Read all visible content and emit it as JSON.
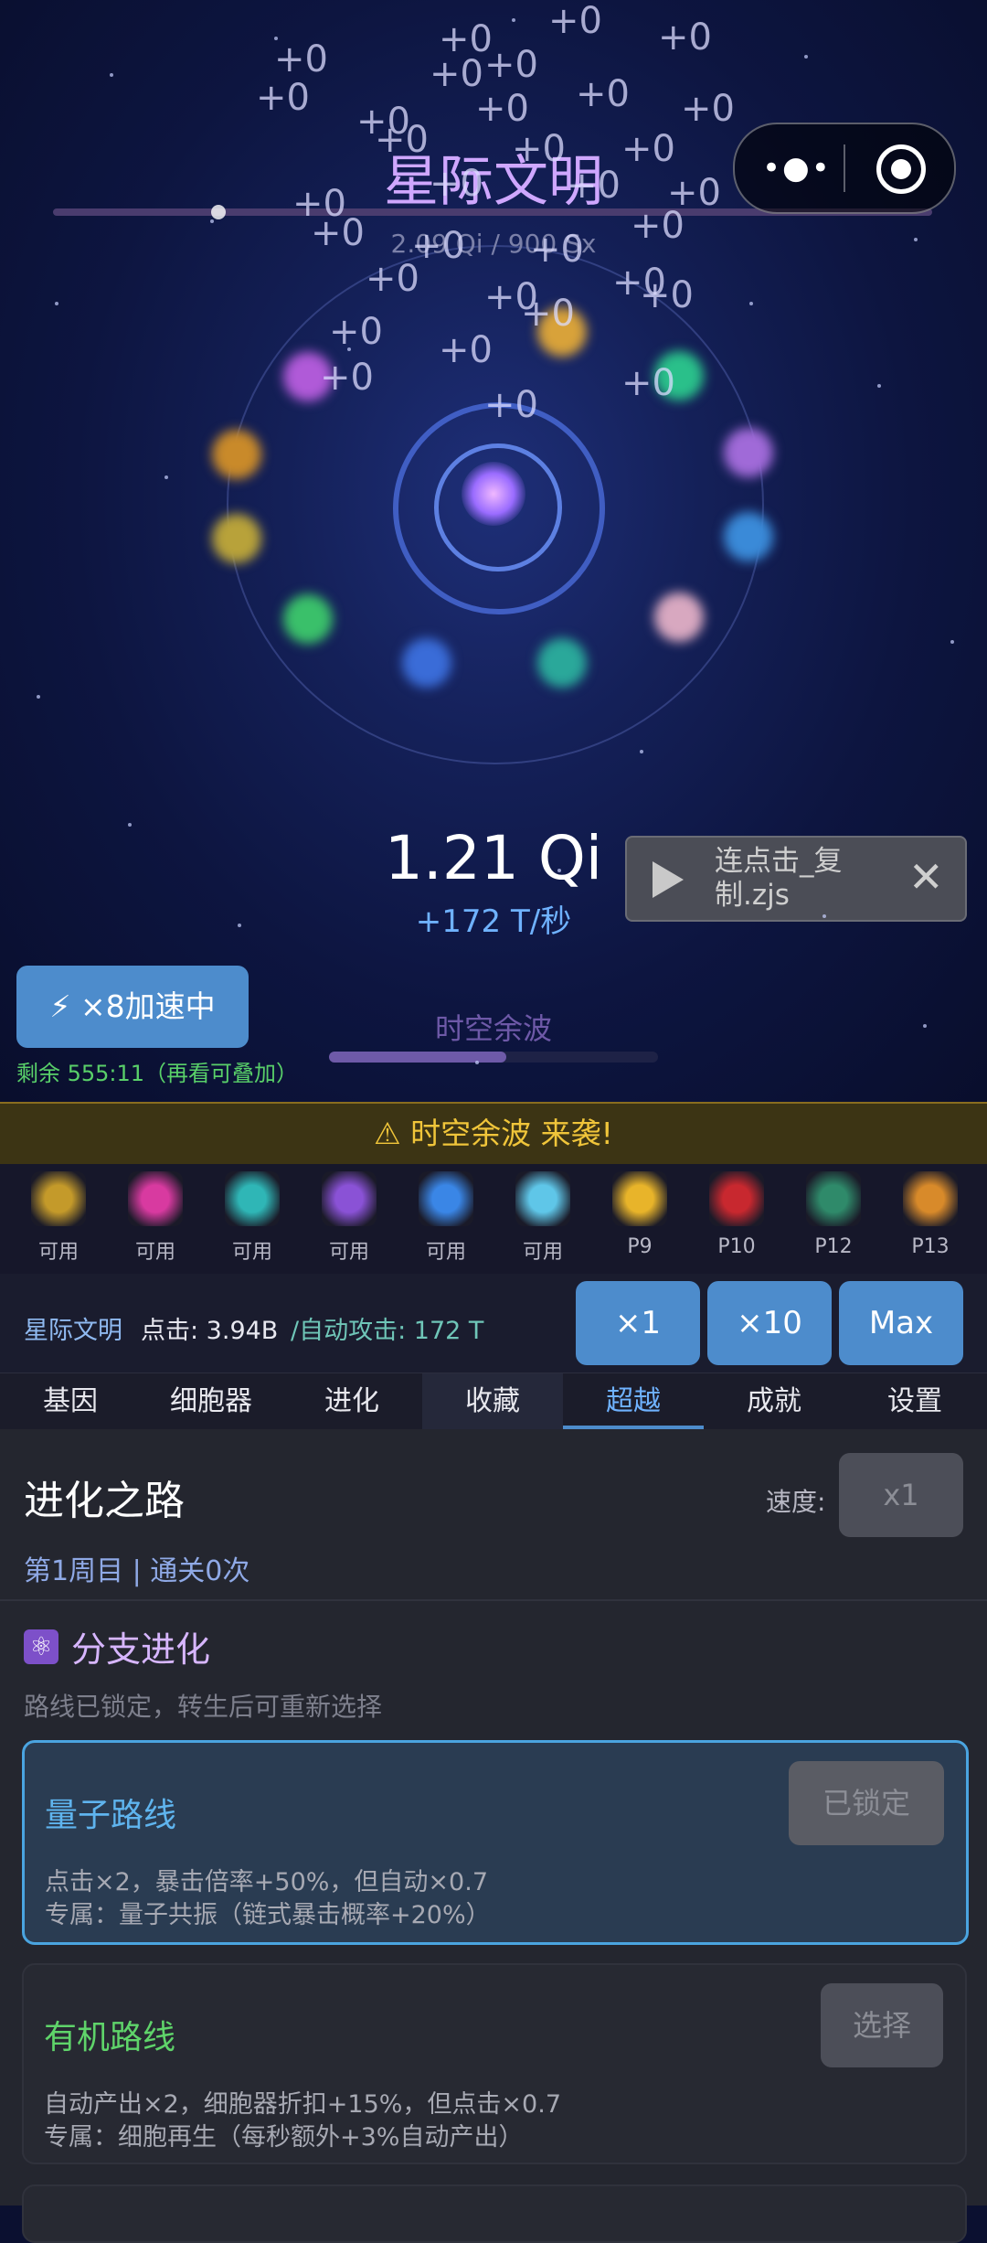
{
  "game": {
    "title": "星际文明",
    "subtitle": "2.09 Qi / 900 Sx",
    "float_text": "+0",
    "counter": "1.21 Qi",
    "rate": "+172 T/秒"
  },
  "script_bar": {
    "label": "连点击_复制.zjs"
  },
  "boost": {
    "label": "⚡ ×8加速中",
    "remaining": "剩余 555:11（再看可叠加）"
  },
  "wave": {
    "label": "时空余波",
    "progress": 0.54
  },
  "alert": {
    "text": "⚠ 时空余波 来袭!"
  },
  "collectibles": [
    {
      "label": "可用",
      "color": "#c49a2a",
      "icon": "gold-burst-icon"
    },
    {
      "label": "可用",
      "color": "#d83aa0",
      "icon": "pink-nebula-icon"
    },
    {
      "label": "可用",
      "color": "#2fb6b6",
      "icon": "teal-ring-icon"
    },
    {
      "label": "可用",
      "color": "#8a52d6",
      "icon": "purple-wheel-icon"
    },
    {
      "label": "可用",
      "color": "#3a86e6",
      "icon": "blue-clock-icon"
    },
    {
      "label": "可用",
      "color": "#5fc6e8",
      "icon": "cyan-cross-icon"
    },
    {
      "label": "P9",
      "color": "#e8b42a",
      "icon": "locked-sun-icon"
    },
    {
      "label": "P10",
      "color": "#c8282f",
      "icon": "locked-red-icon"
    },
    {
      "label": "P12",
      "color": "#2f8a6a",
      "icon": "locked-green-icon"
    },
    {
      "label": "P13",
      "color": "#d88a2a",
      "icon": "locked-orange-icon"
    }
  ],
  "stats": {
    "name": "星际文明",
    "click": "点击: 3.94B",
    "auto": "/自动攻击: 172 T"
  },
  "multipliers": [
    "×1",
    "×10",
    "Max"
  ],
  "tabs": [
    "基因",
    "细胞器",
    "进化",
    "收藏",
    "超越",
    "成就",
    "设置"
  ],
  "active_tab": "超越",
  "panel": {
    "title": "进化之路",
    "speed_label": "速度:",
    "speed_value": "x1",
    "cycle": "第1周目 | 通关0次",
    "branch_title": "分支进化",
    "branch_note": "路线已锁定，转生后可重新选择",
    "routes": [
      {
        "name": "量子路线",
        "color": "#5fb4ee",
        "button": "已锁定",
        "desc1": "点击×2，暴击倍率+50%，但自动×0.7",
        "desc2": "专属：量子共振（链式暴击概率+20%）"
      },
      {
        "name": "有机路线",
        "color": "#5fd46a",
        "button": "选择",
        "desc1": "自动产出×2，细胞器折扣+15%，但点击×0.7",
        "desc2": "专属：细胞再生（每秒额外+3%自动产出）"
      }
    ]
  }
}
